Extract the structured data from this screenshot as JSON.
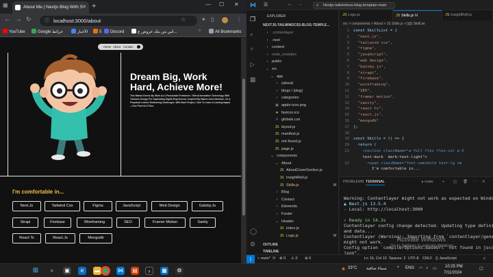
{
  "browser": {
    "tab_title": "About Me | Nextjs Blog With S",
    "url": "localhost:3000/about",
    "bookmarks": [
      "YouTube",
      "Google خرائط",
      "الأخبار",
      "5",
      "Discord",
      "اس من بنك عروض ع...",
      "All Bookmarks"
    ],
    "site_nav": {
      "home": "Home",
      "about": "About",
      "contact": "Contact"
    },
    "headline": "Dream Big, Work Hard, Achieve More!",
    "intro": "This Mantra Drives My Work As A Passionate Freelancer. I Blend Innovative Technology With Timeless Design For Captivating Digital Experiences. Inspired By Nature And Literature, I'm A Perpetual Learner Embracing Challenges. With Each Project, I Aim To Leave A Lasting Impact—One Pixel At A Time.",
    "comfortable_heading": "I'm comfortable in...",
    "skills": [
      "Next.Js",
      "Tailwind Css",
      "Figma",
      "JavaScript",
      "Web Design",
      "Gatsby.Js",
      "Strapi",
      "Firebase",
      "Wireframing",
      "SEO",
      "Framer Motion",
      "Sanity",
      "React Ts",
      "React.Js",
      "Mongodb"
    ]
  },
  "vscode": {
    "menu_icon": "☰",
    "search_text": "Nextjs-tailwindcss-blog-template-main",
    "explorer_label": "EXPLORER",
    "project": "NEXTJS-TAILWINDCSS-BLOG-TEMPLE...",
    "tree": [
      {
        "label": ".contentlayer",
        "type": "folder",
        "indent": 0,
        "dim": true
      },
      {
        "label": ".next",
        "type": "folder",
        "indent": 0,
        "dim": false
      },
      {
        "label": "content",
        "type": "folder",
        "indent": 0,
        "dim": false
      },
      {
        "label": "node_modules",
        "type": "folder",
        "indent": 0,
        "dim": true
      },
      {
        "label": "public",
        "type": "folder",
        "indent": 0,
        "dim": false
      },
      {
        "label": "src",
        "type": "folder-open",
        "indent": 0,
        "dim": false
      },
      {
        "label": "app",
        "type": "folder-open",
        "indent": 1,
        "dim": false
      },
      {
        "label": "(about)",
        "type": "folder",
        "indent": 2,
        "dim": false
      },
      {
        "label": "blogs \\ [slug]",
        "type": "folder",
        "indent": 2,
        "dim": false
      },
      {
        "label": "categories",
        "type": "folder",
        "indent": 2,
        "dim": false
      },
      {
        "label": "apple-icon.png",
        "type": "png",
        "indent": 2,
        "dim": false
      },
      {
        "label": "favicon.ico",
        "type": "ico",
        "indent": 2,
        "dim": false
      },
      {
        "label": "globals.css",
        "type": "css",
        "indent": 2,
        "dim": false
      },
      {
        "label": "layout.js",
        "type": "js",
        "indent": 2,
        "dim": false
      },
      {
        "label": "manifest.js",
        "type": "js",
        "indent": 2,
        "dim": false
      },
      {
        "label": "not-found.js",
        "type": "js",
        "indent": 2,
        "dim": false
      },
      {
        "label": "page.js",
        "type": "js",
        "indent": 2,
        "dim": false
      },
      {
        "label": "components",
        "type": "folder-open",
        "indent": 1,
        "dim": false
      },
      {
        "label": "About",
        "type": "folder-open",
        "indent": 2,
        "dim": false
      },
      {
        "label": "AboutCoverSection.js",
        "type": "js",
        "indent": 3,
        "dim": false
      },
      {
        "label": "InsightRoll.js",
        "type": "js",
        "indent": 3,
        "dim": false
      },
      {
        "label": "Skills.js",
        "type": "js",
        "indent": 3,
        "dim": false,
        "status": "M"
      },
      {
        "label": "Blog",
        "type": "folder",
        "indent": 2,
        "dim": false
      },
      {
        "label": "Contact",
        "type": "folder",
        "indent": 2,
        "dim": false
      },
      {
        "label": "Elements",
        "type": "folder",
        "indent": 2,
        "dim": false
      },
      {
        "label": "Footer",
        "type": "folder",
        "indent": 2,
        "dim": false
      },
      {
        "label": "Header",
        "type": "folder-open",
        "indent": 2,
        "dim": false
      },
      {
        "label": "index.js",
        "type": "js",
        "indent": 3,
        "dim": false
      },
      {
        "label": "Logo.js",
        "type": "js",
        "indent": 3,
        "dim": false,
        "status": "M"
      }
    ],
    "outline_label": "OUTLINE",
    "timeline_label": "TIMELINE",
    "editor_tabs": [
      "Logo.js",
      "Skills.js",
      "InsightRoll.js"
    ],
    "editor_tab_badge": "M",
    "breadcrumb": "src > components > About > JS Skills.js > [@] SkillList",
    "code_lines": [
      {
        "n": "1",
        "t": "const SkillList = ["
      },
      {
        "n": "2",
        "t": "  \"next.js\","
      },
      {
        "n": "3",
        "t": "  \"tailwind css\","
      },
      {
        "n": "4",
        "t": "  \"figma\","
      },
      {
        "n": "5",
        "t": "  \"javaScript\","
      },
      {
        "n": "6",
        "t": "  \"web design\","
      },
      {
        "n": "7",
        "t": "  \"Gatsby.js\","
      },
      {
        "n": "8",
        "t": "  \"strapi\","
      },
      {
        "n": "9",
        "t": "  \"firebase\","
      },
      {
        "n": "10",
        "t": "  \"wireframing\","
      },
      {
        "n": "11",
        "t": "  \"SEO\","
      },
      {
        "n": "12",
        "t": "  \"framer motion\","
      },
      {
        "n": "13",
        "t": "  \"sanity\","
      },
      {
        "n": "14",
        "t": "  \"react ts\","
      },
      {
        "n": "15",
        "t": "  \"react.js\","
      },
      {
        "n": "16",
        "t": "  \"mongodb\""
      },
      {
        "n": "17",
        "t": "];"
      },
      {
        "n": "18",
        "t": ""
      },
      {
        "n": "19",
        "t": "const Skills = () => {"
      },
      {
        "n": "20",
        "t": "  return ("
      },
      {
        "n": "21",
        "t": "    <section className=\"w-full flex flex-col p-5"
      },
      {
        "n": "",
        "t": "    text-dark  dark:text-light\">"
      },
      {
        "n": "22",
        "t": "      <span className=\"font-semibold text-lg sm"
      },
      {
        "n": "",
        "t": "        I'm comfortable in..."
      }
    ],
    "panel_tabs": [
      "PROBLEMS",
      "TERMINAL"
    ],
    "terminal_shell": "node",
    "terminal_lines": [
      "Warning: Contentlayer might not work as expected on Windows",
      "  ▲ Next.js 13.5.4",
      "  - Local:        http://localhost:3000",
      "",
      " ✓ Ready in 54.3s",
      "Contentlayer config change detected. Updating type definitions",
      " and data...",
      "Contentlayer (Warning): Importing from `contentlayer/generated`",
      " might not work.",
      "Config option `compilerOptions.baseUrl` not found in jsconfig.",
      "json\"."
    ],
    "watermark_title": "Activate Windows",
    "watermark_sub": "Go to Settings to activate Windows.",
    "status": {
      "branch": "main*",
      "sync": "⟳",
      "errors": "⊗ 0",
      "warnings": "⚠ 0",
      "ports": "⊕ 0",
      "position": "Ln 16, Col 13",
      "spaces": "Spaces: 2",
      "encoding": "UTF-8",
      "eol": "CRLF",
      "lang": "{} JavaScript"
    }
  },
  "taskbar": {
    "weather_temp": "33°C",
    "weather_text": "سماء صافية",
    "lang": "ENG",
    "time": "10:25 PM",
    "date": "7/11/2024"
  }
}
